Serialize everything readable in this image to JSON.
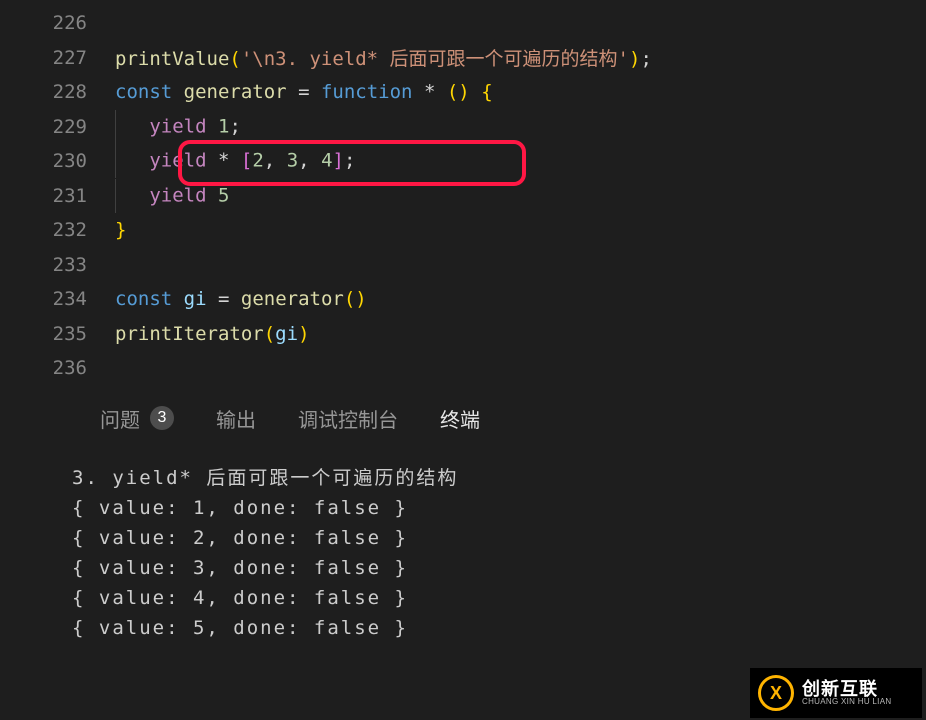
{
  "editor": {
    "lines": [
      {
        "num": "226",
        "html": ""
      },
      {
        "num": "227",
        "html": "<span class='call'>printValue</span><span class='gb'>(</span><span class='str'>'\\n3. yield* 后面可跟一个可遍历的结构'</span><span class='gb'>)</span><span class='pl'>;</span>"
      },
      {
        "num": "228",
        "html": "<span class='fn'>const</span> <span class='call'>generator</span> <span class='op'>=</span> <span class='fn'>function</span> <span class='op'>*</span> <span class='gb'>()</span> <span class='gb'>{</span>"
      },
      {
        "num": "229",
        "html": "<span class='indent-guide'></span>   <span class='kw'>yield</span> <span class='num'>1</span><span class='pl'>;</span>"
      },
      {
        "num": "230",
        "html": "<span class='indent-guide'></span>   <span class='kw'>yield</span> <span class='op'>*</span> <span class='pb'>[</span><span class='num'>2</span><span class='pl'>,</span> <span class='num'>3</span><span class='pl'>,</span> <span class='num'>4</span><span class='pb'>]</span><span class='pl'>;</span>"
      },
      {
        "num": "231",
        "html": "<span class='indent-guide'></span>   <span class='kw'>yield</span> <span class='num'>5</span>"
      },
      {
        "num": "232",
        "html": "<span class='gb'>}</span>"
      },
      {
        "num": "233",
        "html": ""
      },
      {
        "num": "234",
        "html": "<span class='fn'>const</span> <span class='var'>gi</span> <span class='op'>=</span> <span class='call'>generator</span><span class='gb'>()</span>"
      },
      {
        "num": "235",
        "html": "<span class='call'>printIterator</span><span class='gb'>(</span><span class='var'>gi</span><span class='gb'>)</span>"
      },
      {
        "num": "236",
        "html": ""
      }
    ]
  },
  "panel": {
    "tabs": {
      "problems": "问题",
      "problems_count": "3",
      "output": "输出",
      "debug": "调试控制台",
      "terminal": "终端"
    }
  },
  "terminal": {
    "lines": [
      "3. yield* 后面可跟一个可遍历的结构",
      "{ value: 1, done: false }",
      "{ value: 2, done: false }",
      "{ value: 3, done: false }",
      "{ value: 4, done: false }",
      "{ value: 5, done: false }"
    ]
  },
  "logo": {
    "cn": "创新互联",
    "en": "CHUANG XIN HU LIAN",
    "mark": "X"
  }
}
